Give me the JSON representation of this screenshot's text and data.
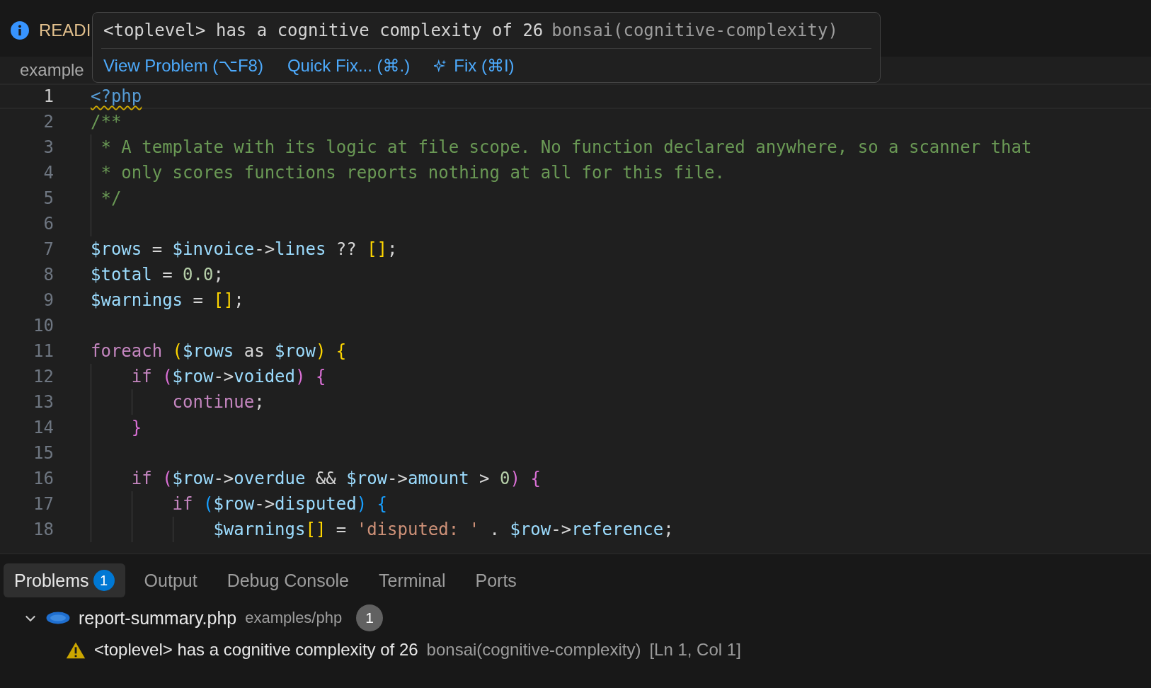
{
  "editor_tab": {
    "label": "READI"
  },
  "breadcrumb": "example",
  "hover": {
    "message": "<toplevel> has a cognitive complexity of 26",
    "source": "bonsai(cognitive-complexity)",
    "actions": [
      {
        "label": "View Problem (⌥F8)",
        "kind": "link"
      },
      {
        "label": "Quick Fix... (⌘.)",
        "kind": "link"
      },
      {
        "label": "Fix (⌘I)",
        "kind": "ai"
      }
    ]
  },
  "code": {
    "lines": [
      {
        "number": "1",
        "current": true,
        "warning": true,
        "tokens": [
          {
            "t": "<?php",
            "kind": "tag"
          }
        ]
      },
      {
        "number": "2",
        "current": false,
        "warning": false,
        "tokens": [
          {
            "t": "/**",
            "kind": "comment"
          }
        ]
      },
      {
        "number": "3",
        "current": false,
        "warning": false,
        "tokens": [
          {
            "t": " * A template with its logic at file scope. No function declared anywhere, so a scanner that",
            "kind": "comment"
          }
        ]
      },
      {
        "number": "4",
        "current": false,
        "warning": false,
        "tokens": [
          {
            "t": " * only scores functions reports nothing at all for this file.",
            "kind": "comment"
          }
        ]
      },
      {
        "number": "5",
        "current": false,
        "warning": false,
        "tokens": [
          {
            "t": " */",
            "kind": "comment"
          }
        ]
      },
      {
        "number": "6",
        "current": false,
        "warning": false
      },
      {
        "number": "7",
        "current": false,
        "warning": false,
        "tokens": [
          {
            "t": "$rows",
            "kind": "var"
          },
          {
            "t": " = ",
            "kind": "plain"
          },
          {
            "t": "$invoice",
            "kind": "var"
          },
          {
            "t": "->",
            "kind": "plain"
          },
          {
            "t": "lines",
            "kind": "var"
          },
          {
            "t": " ?? ",
            "kind": "plain"
          },
          {
            "t": "[]",
            "kind": "b1"
          },
          {
            "t": ";",
            "kind": "plain"
          }
        ]
      },
      {
        "number": "8",
        "current": false,
        "warning": false,
        "tokens": [
          {
            "t": "$total",
            "kind": "var"
          },
          {
            "t": " = ",
            "kind": "plain"
          },
          {
            "t": "0.0",
            "kind": "num"
          },
          {
            "t": ";",
            "kind": "plain"
          }
        ]
      },
      {
        "number": "9",
        "current": false,
        "warning": false,
        "tokens": [
          {
            "t": "$warnings",
            "kind": "var"
          },
          {
            "t": " = ",
            "kind": "plain"
          },
          {
            "t": "[]",
            "kind": "b1"
          },
          {
            "t": ";",
            "kind": "plain"
          }
        ]
      },
      {
        "number": "10",
        "current": false,
        "warning": false
      },
      {
        "number": "11",
        "current": false,
        "warning": false,
        "tokens": [
          {
            "t": "foreach ",
            "kind": "kw"
          },
          {
            "t": "(",
            "kind": "b1"
          },
          {
            "t": "$rows",
            "kind": "var"
          },
          {
            "t": " as ",
            "kind": "plain"
          },
          {
            "t": "$row",
            "kind": "var"
          },
          {
            "t": ") {",
            "kind": "b1"
          }
        ]
      },
      {
        "number": "12",
        "current": false,
        "warning": false,
        "tokens": [
          {
            "t": "    if ",
            "kind": "kw"
          },
          {
            "t": "(",
            "kind": "b2"
          },
          {
            "t": "$row",
            "kind": "var"
          },
          {
            "t": "->",
            "kind": "plain"
          },
          {
            "t": "voided",
            "kind": "var"
          },
          {
            "t": ") {",
            "kind": "b2"
          }
        ]
      },
      {
        "number": "13",
        "current": false,
        "warning": false,
        "tokens": [
          {
            "t": "        continue",
            "kind": "kw"
          },
          {
            "t": ";",
            "kind": "plain"
          }
        ]
      },
      {
        "number": "14",
        "current": false,
        "warning": false,
        "tokens": [
          {
            "t": "    }",
            "kind": "b2"
          }
        ]
      },
      {
        "number": "15",
        "current": false,
        "warning": false
      },
      {
        "number": "16",
        "current": false,
        "warning": false,
        "tokens": [
          {
            "t": "    if ",
            "kind": "kw"
          },
          {
            "t": "(",
            "kind": "b2"
          },
          {
            "t": "$row",
            "kind": "var"
          },
          {
            "t": "->",
            "kind": "plain"
          },
          {
            "t": "overdue",
            "kind": "var"
          },
          {
            "t": " && ",
            "kind": "plain"
          },
          {
            "t": "$row",
            "kind": "var"
          },
          {
            "t": "->",
            "kind": "plain"
          },
          {
            "t": "amount",
            "kind": "var"
          },
          {
            "t": " > ",
            "kind": "plain"
          },
          {
            "t": "0",
            "kind": "num"
          },
          {
            "t": ") {",
            "kind": "b2"
          }
        ]
      },
      {
        "number": "17",
        "current": false,
        "warning": false,
        "tokens": [
          {
            "t": "        if ",
            "kind": "kw"
          },
          {
            "t": "(",
            "kind": "b3"
          },
          {
            "t": "$row",
            "kind": "var"
          },
          {
            "t": "->",
            "kind": "plain"
          },
          {
            "t": "disputed",
            "kind": "var"
          },
          {
            "t": ") {",
            "kind": "b3"
          }
        ]
      },
      {
        "number": "18",
        "current": false,
        "warning": false,
        "tokens": [
          {
            "t": "            $warnings",
            "kind": "var"
          },
          {
            "t": "[]",
            "kind": "b1"
          },
          {
            "t": " = ",
            "kind": "plain"
          },
          {
            "t": "'disputed: '",
            "kind": "str"
          },
          {
            "t": " . ",
            "kind": "plain"
          },
          {
            "t": "$row",
            "kind": "var"
          },
          {
            "t": "->",
            "kind": "plain"
          },
          {
            "t": "reference",
            "kind": "var"
          },
          {
            "t": ";",
            "kind": "plain"
          }
        ]
      }
    ]
  },
  "panel": {
    "tabs": [
      {
        "label": "Problems",
        "selected": true,
        "badge": "1"
      },
      {
        "label": "Output",
        "selected": false
      },
      {
        "label": "Debug Console",
        "selected": false
      },
      {
        "label": "Terminal",
        "selected": false
      },
      {
        "label": "Ports",
        "selected": false
      }
    ],
    "file": {
      "name": "report-summary.php",
      "path": "examples/php",
      "count": "1",
      "expanded": true
    },
    "problems": [
      {
        "kind": "warning",
        "message": "<toplevel> has a cognitive complexity of 26",
        "source": "bonsai(cognitive-complexity)",
        "location": "[Ln 1, Col 1]"
      }
    ]
  }
}
